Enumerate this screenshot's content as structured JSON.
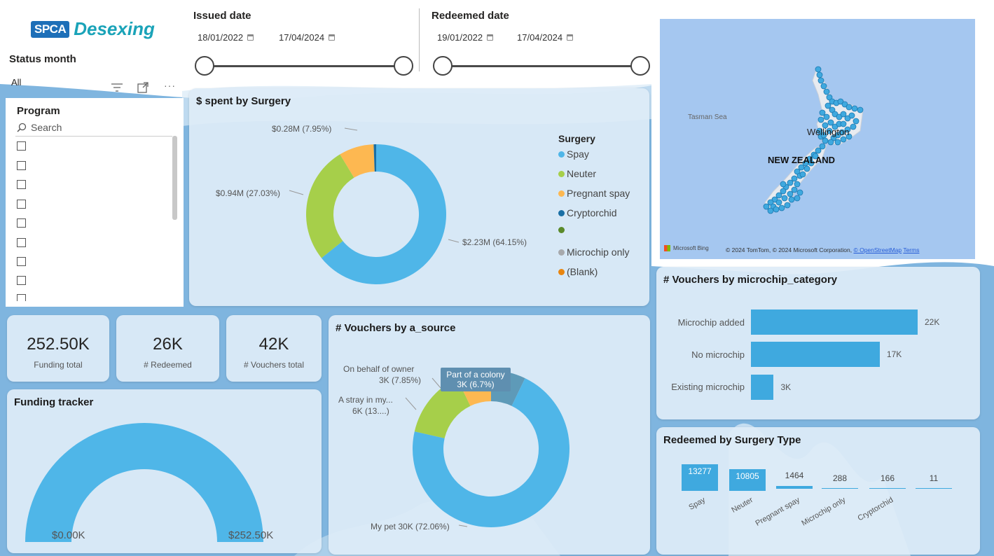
{
  "logo": {
    "badge": "SPCA",
    "title": "Desexing"
  },
  "issued_date": {
    "title": "Issued date",
    "start": "18/01/2022",
    "end": "17/04/2024"
  },
  "redeemed_date": {
    "title": "Redeemed date",
    "start": "19/01/2022",
    "end": "17/04/2024"
  },
  "status_month": {
    "title": "Status month",
    "value": "All"
  },
  "program": {
    "title": "Program",
    "search_placeholder": "Search",
    "checkbox_count": 9
  },
  "kpis": [
    {
      "value": "252.50K",
      "label": "Funding total"
    },
    {
      "value": "26K",
      "label": "# Redeemed"
    },
    {
      "value": "42K",
      "label": "# Vouchers total"
    }
  ],
  "map": {
    "sea_label": "Tasman Sea",
    "country_label": "NEW ZEALAND",
    "city_label": "Wellington",
    "provider": "Microsoft Bing",
    "attribution": "© 2024 TomTom, © 2024 Microsoft Corporation,",
    "osm_link": "© OpenStreetMap",
    "terms_link": "Terms"
  },
  "colors": {
    "spay": "#4fb6e8",
    "neuter": "#a6cf4a",
    "pregnant_spay": "#fdb851",
    "cryptorchid": "#1a6fa5",
    "blank_green": "#5a8a2a",
    "microchip_only": "#a7a9ac",
    "blank": "#e8850f",
    "bar": "#3fa9df"
  },
  "chart_data": [
    {
      "type": "pie",
      "title": "$ spent by Surgery",
      "legend_title": "Surgery",
      "categories": [
        "Spay",
        "Neuter",
        "Pregnant spay",
        "Cryptorchid",
        "",
        "Microchip only",
        "(Blank)"
      ],
      "values": [
        2.23,
        0.94,
        0.28,
        0.02,
        0,
        0,
        0
      ],
      "labels": [
        "$2.23M (64.15%)",
        "$0.94M (27.03%)",
        "$0.28M (7.95%)"
      ],
      "legend_placement": "right"
    },
    {
      "type": "pie",
      "title": "# Vouchers by a_source",
      "categories": [
        "My pet",
        "A stray in my...",
        "On behalf of owner",
        "Part of a colony"
      ],
      "values": [
        30,
        6,
        3,
        3
      ],
      "percents": [
        72.06,
        13.4,
        7.85,
        6.7
      ],
      "labels": [
        "My pet 30K (72.06%)",
        "A stray in my...",
        "6K (13....)",
        "On behalf of owner",
        "3K (7.85%)",
        "Part of a colony",
        "3K (6.7%)"
      ]
    },
    {
      "type": "bar",
      "title": "# Vouchers by microchip_category",
      "categories": [
        "Microchip added",
        "No microchip",
        "Existing microchip"
      ],
      "values": [
        22,
        17,
        3
      ],
      "value_labels": [
        "22K",
        "17K",
        "3K"
      ],
      "orientation": "horizontal"
    },
    {
      "type": "bar",
      "title": "Redeemed by Surgery Type",
      "categories": [
        "Spay",
        "Neuter",
        "Pregnant spay",
        "Microchip only",
        "Cryptorchid",
        ""
      ],
      "values": [
        13277,
        10805,
        1464,
        288,
        166,
        11
      ],
      "value_labels": [
        "13277",
        "10805",
        "1464",
        "288",
        "166",
        "11"
      ]
    },
    {
      "type": "gauge",
      "title": "Funding tracker",
      "value": 252.5,
      "min": 0,
      "max": 252.5,
      "min_label": "$0.00K",
      "max_label": "$252.50K"
    }
  ]
}
